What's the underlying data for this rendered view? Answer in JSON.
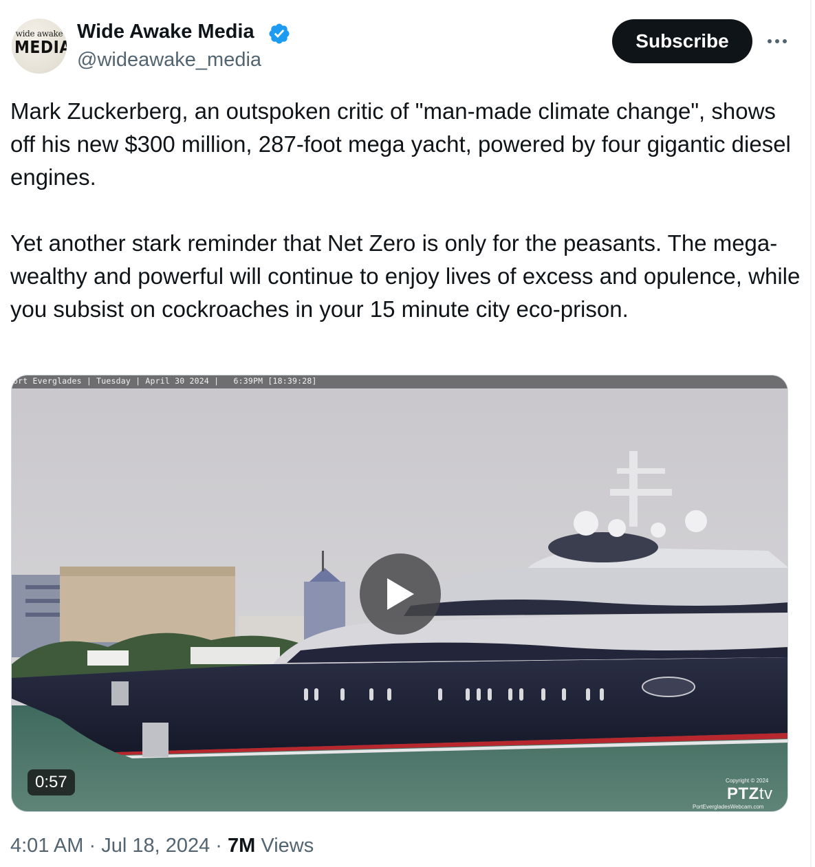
{
  "author": {
    "avatar_text_top": "wide awake",
    "avatar_text_bottom": "MEDIA",
    "display_name": "Wide Awake Media",
    "handle": "@wideawake_media",
    "verified_icon": "verified-badge-icon"
  },
  "actions": {
    "subscribe_label": "Subscribe",
    "more_icon": "more-horizontal-icon"
  },
  "tweet": {
    "paragraph_1": "Mark Zuckerberg, an outspoken critic of \"man-made climate change\", shows off his new $300 million, 287-foot mega yacht, powered by four gigantic diesel engines.",
    "paragraph_2": "Yet another stark reminder that Net Zero is only for the peasants. The mega-wealthy and powerful will continue to enjoy lives of excess and opulence, while you subsist on cockroaches in your 15 minute city eco-prison."
  },
  "video": {
    "cam_overlay": "ort Everglades | Tuesday | April 30 2024 |   6:39PM [18:39:28]",
    "duration": "0:57",
    "play_icon": "play-icon",
    "watermark_copyright": "Copyright © 2024",
    "watermark_logo": "PTZ",
    "watermark_logo_suffix": "tv",
    "watermark_url": "PortEvergladesWebcam.com"
  },
  "meta": {
    "time": "4:01 AM",
    "date": "Jul 18, 2024",
    "separator": "·",
    "views_count": "7M",
    "views_label": "Views"
  },
  "colors": {
    "text_primary": "#0f1419",
    "text_secondary": "#536471",
    "verified_blue": "#1d9bf0",
    "subscribe_bg": "#0f1419"
  }
}
